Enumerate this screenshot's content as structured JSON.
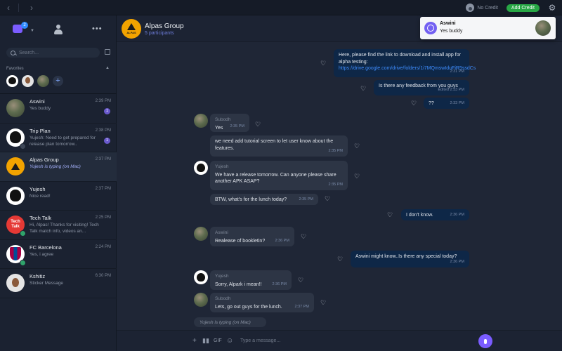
{
  "topbar": {
    "no_credit": "No Credit",
    "add_credit": "Add Credit"
  },
  "sidebar": {
    "chat_badge": "2",
    "search_placeholder": "Search...",
    "favorites_label": "Favorites",
    "chats": [
      {
        "name": "Aswini",
        "time": "2:39 PM",
        "preview": "Yes buddy",
        "unread": "1"
      },
      {
        "name": "Trip Plan",
        "time": "2:38 PM",
        "preview": "Yujesh: Need to get prepared for release plan tomorrow..",
        "unread": "1"
      },
      {
        "name": "Alpas Group",
        "time": "2:37 PM",
        "preview": "Yujesh is typing (on Mac)"
      },
      {
        "name": "Yujesh",
        "time": "2:37 PM",
        "preview": "Nice read!"
      },
      {
        "name": "Tech Talk",
        "time": "2:25 PM",
        "preview": "Hi, Alpas! Thanks for visiting! Tech Talk match info, videos an..."
      },
      {
        "name": "FC Barcelona",
        "time": "2:24 PM",
        "preview": "Yes, i agree"
      },
      {
        "name": "Kshitiz",
        "time": "6:30 PM",
        "preview": "Sticker Message"
      }
    ],
    "tech_talk_logo": "Tech Talk"
  },
  "header": {
    "group_name": "Alpas Group",
    "participants": "5 participants",
    "avatar_text": "ALPAS"
  },
  "messages": [
    {
      "dir": "out",
      "text": "Here, please find the link to download and install app for alpha testing: ",
      "link": "https://drive.google.com/drive/folders/1i7MQmswIduFiR5ssdCs",
      "time": "2:31 PM"
    },
    {
      "dir": "out",
      "text": "Is there any feedback from you guys",
      "time": "Edited 2:33 PM"
    },
    {
      "dir": "out",
      "text": "??",
      "time": "2:33 PM"
    },
    {
      "dir": "in",
      "sender": "Subodh",
      "text": "Yes",
      "time": "2:35 PM"
    },
    {
      "dir": "in",
      "text": "we need add tutorial screen to let user know about the features.",
      "time": "2:35 PM"
    },
    {
      "dir": "in",
      "sender": "Yujesh",
      "text": "We have a release tomorrow. Can anyone please share another APK ASAP?",
      "time": "2:35 PM"
    },
    {
      "dir": "in",
      "text": "BTW, what's for the lunch today?",
      "time": "2:35 PM"
    },
    {
      "dir": "out",
      "text": "I don't know.",
      "time": "2:36 PM"
    },
    {
      "dir": "in",
      "sender": "Aswini",
      "text": "Realease of bookletin?",
      "time": "2:36 PM"
    },
    {
      "dir": "out",
      "text": "Aswini might know..Is there any special today?",
      "time": "2:36 PM"
    },
    {
      "dir": "in",
      "sender": "Yujesh",
      "text": "Sorry, Alpark i mean!!",
      "time": "2:36 PM"
    },
    {
      "dir": "in",
      "sender": "Subodh",
      "text": "Lets, go out guys for the lunch.",
      "time": "2:37 PM"
    }
  ],
  "typing_indicator": "Yujesh is typing (on Mac)",
  "composer": {
    "placeholder": "Type a message..."
  },
  "notification": {
    "name": "Aswini",
    "text": "Yes buddy"
  },
  "colors": {
    "accent": "#7a5cff",
    "add_credit": "#28a745",
    "outgoing_bubble": "#0e2747",
    "incoming_bubble": "#2d3545"
  }
}
